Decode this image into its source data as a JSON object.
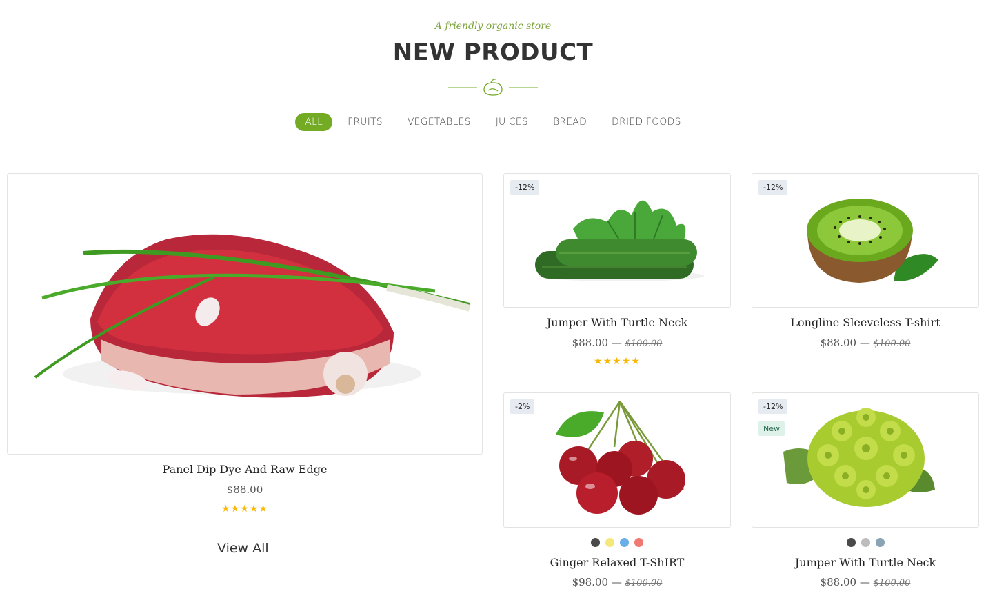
{
  "header": {
    "tagline": "A friendly organic store",
    "title": "NEW PRODUCT"
  },
  "tabs": [
    {
      "label": "ALL",
      "active": true
    },
    {
      "label": "FRUITS"
    },
    {
      "label": "VEGETABLES"
    },
    {
      "label": "JUICES"
    },
    {
      "label": "BREAD"
    },
    {
      "label": "DRIED FOODS"
    }
  ],
  "featured": {
    "name": "Panel Dip Dye And Raw Edge",
    "price": "$88.00",
    "rating": "★★★★★",
    "image_icon": "steak-image"
  },
  "products": [
    {
      "name": "Jumper With Turtle Neck",
      "price": "$88.00",
      "dash": "—",
      "old_price": "$100.00",
      "badge": "-12%",
      "rating": "★★★★★",
      "image_icon": "zucchini-image"
    },
    {
      "name": "Longline Sleeveless T-shirt",
      "price": "$88.00",
      "dash": "—",
      "old_price": "$100.00",
      "badge": "-12%",
      "image_icon": "kiwi-image"
    },
    {
      "name": "Ginger Relaxed T-ShIRT",
      "price": "$98.00",
      "dash": "—",
      "old_price": "$100.00",
      "badge": "-2%",
      "swatches": [
        "#4a4a4a",
        "#f5e87a",
        "#6aaee8",
        "#f07a72"
      ],
      "image_icon": "cherries-image"
    },
    {
      "name": "Jumper With Turtle Neck",
      "price": "$88.00",
      "dash": "—",
      "old_price": "$100.00",
      "badge": "-12%",
      "badge2": "New",
      "swatches": [
        "#4a4a4a",
        "#bdbdbd",
        "#8aa4b4"
      ],
      "image_icon": "romanesco-image"
    }
  ],
  "view_all": "View All",
  "colors": {
    "accent": "#73ab25",
    "star": "#f8b805"
  }
}
